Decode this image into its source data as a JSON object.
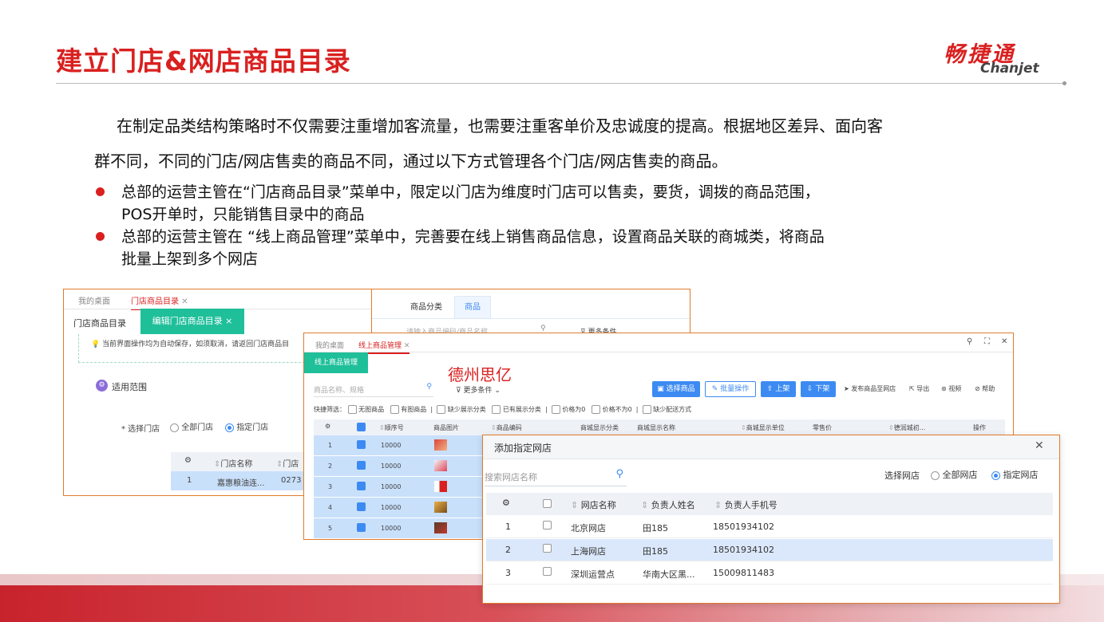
{
  "slide": {
    "title": "建立门店&网店商品目录",
    "logo_cn": "畅捷通",
    "logo_en": "Chanjet",
    "para1": "在制定品类结构策略时不仅需要注重增加客流量，也需要注重客单价及忠诚度的提高。根据地区差异、面向客",
    "para2": "群不同，不同的门店/网店售卖的商品不同，通过以下方式管理各个门店/网店售卖的商品。",
    "bullets": [
      {
        "line1": "总部的运营主管在“门店商品目录”菜单中，限定以门店为维度时门店可以售卖，要货，调拨的商品范围，",
        "line2": "POS开单时，只能销售目录中的商品"
      },
      {
        "line1": "总部的运营主管在 “线上商品管理”菜单中，完善要在线上销售商品信息，设置商品关联的商城类，将商品",
        "line2": "批量上架到多个网店"
      }
    ],
    "colors": {
      "accent": "#d9201f",
      "blue": "#3d8bf2",
      "teal": "#1fbf9a"
    }
  },
  "shot1": {
    "tabs": [
      "我的桌面",
      "门店商品目录"
    ],
    "crumb": "门店商品目录",
    "edit_tab": "编辑门店商品目录 ×",
    "notice": "当前界面操作均为自动保存，如须取消，请返回门店商品目",
    "section": "适用范围",
    "select_label": "* 选择门店",
    "radio_all": "全部门店",
    "radio_spec": "指定门店",
    "col_name": "门店名称",
    "col_code": "门店",
    "row": {
      "no": "1",
      "name": "嘉惠粮油连...",
      "code": "0273"
    }
  },
  "shot_back": {
    "tab1": "商品分类",
    "tab2": "商品",
    "search_ph": "请输入商品编码/商品名称",
    "more": "更多条件"
  },
  "shot2": {
    "tabs": [
      "我的桌面",
      "线上商品管理"
    ],
    "menu": "线上商品管理",
    "watermark": "德州思亿",
    "search_ph": "商品名称、规格",
    "more": "更多条件",
    "buttons": [
      "选择商品",
      "批量操作",
      "上架",
      "下架"
    ],
    "links": [
      "发布商品至网店",
      "导出",
      "视频",
      "帮助"
    ],
    "quick_label": "快捷筛选：",
    "quick": [
      "无图商品",
      "有图商品",
      "缺少展示分类",
      "已有展示分类",
      "价格为0",
      "价格不为0",
      "缺少配送方式"
    ],
    "headers": [
      "顺序号",
      "商品图片",
      "商品编码",
      "商城显示分类",
      "商城显示名称",
      "商城显示单位",
      "零售价",
      "德润城初...",
      "操作"
    ],
    "rows": [
      {
        "no": "1",
        "seq": "10000"
      },
      {
        "no": "2",
        "seq": "10000"
      },
      {
        "no": "3",
        "seq": "10000"
      },
      {
        "no": "4",
        "seq": "10000"
      },
      {
        "no": "5",
        "seq": "10000"
      }
    ]
  },
  "dialog": {
    "title": "添加指定网店",
    "search_ph": "搜索网店名称",
    "select_label": "选择网店",
    "radio_all": "全部网店",
    "radio_spec": "指定网店",
    "headers": [
      "网店名称",
      "负责人姓名",
      "负责人手机号"
    ],
    "rows": [
      {
        "no": "1",
        "name": "北京网店",
        "person": "田185",
        "phone": "18501934102"
      },
      {
        "no": "2",
        "name": "上海网店",
        "person": "田185",
        "phone": "18501934102"
      },
      {
        "no": "3",
        "name": "深圳运营点",
        "person": "华南大区黑...",
        "phone": "15009811483"
      }
    ]
  }
}
